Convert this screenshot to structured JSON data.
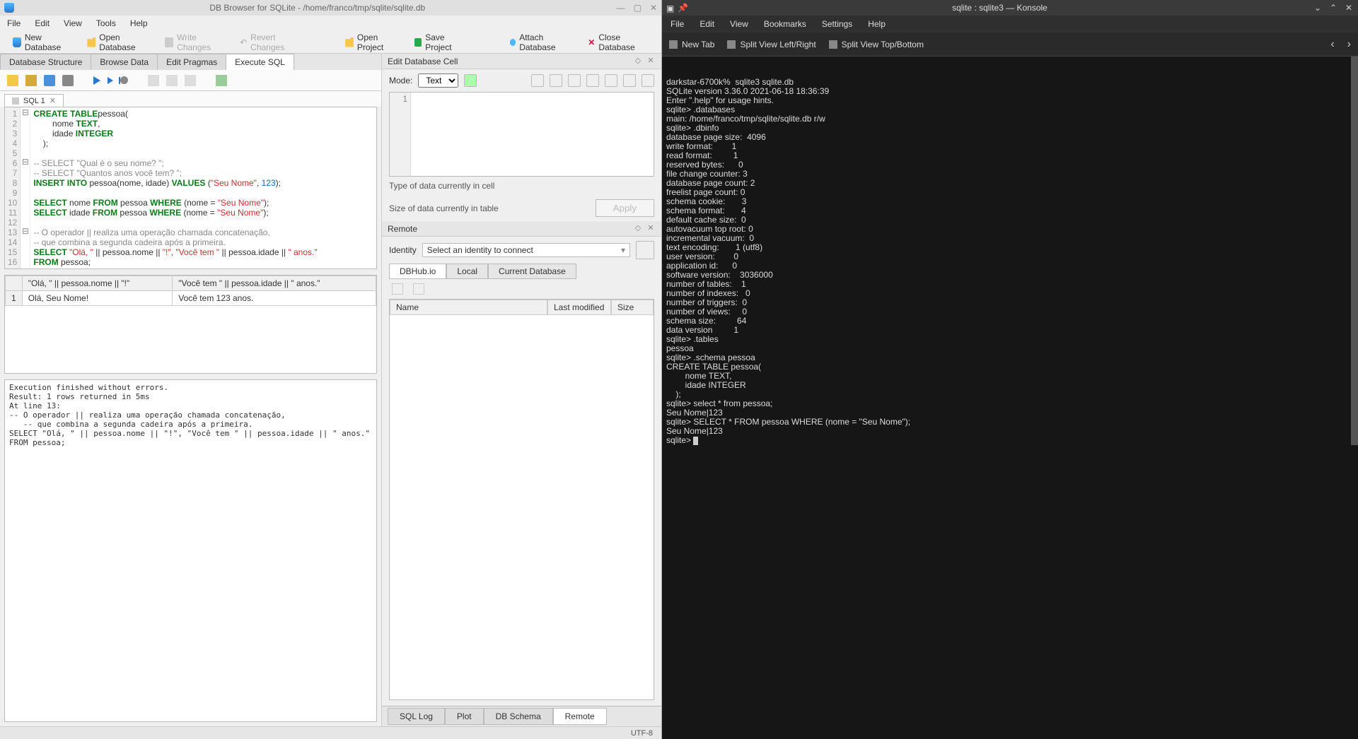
{
  "dbbrowser": {
    "title": "DB Browser for SQLite - /home/franco/tmp/sqlite/sqlite.db",
    "menu": [
      "File",
      "Edit",
      "View",
      "Tools",
      "Help"
    ],
    "toolbar": {
      "new_db": "New Database",
      "open_db": "Open Database",
      "write": "Write Changes",
      "revert": "Revert Changes",
      "open_proj": "Open Project",
      "save_proj": "Save Project",
      "attach": "Attach Database",
      "close": "Close Database"
    },
    "tabs": [
      "Database Structure",
      "Browse Data",
      "Edit Pragmas",
      "Execute SQL"
    ],
    "active_tab": 3,
    "sql_tab": "SQL 1",
    "code_lines": [
      {
        "n": 1,
        "parts": [
          [
            "kw",
            "CREATE TABLE"
          ],
          [
            "",
            ""
          ],
          [
            "",
            "pessoa("
          ]
        ]
      },
      {
        "n": 2,
        "parts": [
          [
            "",
            "        nome "
          ],
          [
            "dk",
            "TEXT"
          ],
          [
            "",
            ","
          ]
        ]
      },
      {
        "n": 3,
        "parts": [
          [
            "",
            "        idade "
          ],
          [
            "dk",
            "INTEGER"
          ]
        ]
      },
      {
        "n": 4,
        "parts": [
          [
            "",
            "    );"
          ]
        ]
      },
      {
        "n": 5,
        "parts": [
          [
            "",
            ""
          ]
        ]
      },
      {
        "n": 6,
        "parts": [
          [
            "cmt",
            "-- SELECT \"Qual é o seu nome? \";"
          ]
        ]
      },
      {
        "n": 7,
        "parts": [
          [
            "cmt",
            "-- SELECT \"Quantos anos você tem? \";"
          ]
        ]
      },
      {
        "n": 8,
        "parts": [
          [
            "kw",
            "INSERT INTO"
          ],
          [
            "",
            " pessoa(nome, idade) "
          ],
          [
            "kw",
            "VALUES"
          ],
          [
            "",
            " ("
          ],
          [
            "str",
            "\"Seu Nome\""
          ],
          [
            "",
            ", "
          ],
          [
            "num",
            "123"
          ],
          [
            "",
            ");"
          ]
        ]
      },
      {
        "n": 9,
        "parts": [
          [
            "",
            ""
          ]
        ]
      },
      {
        "n": 10,
        "parts": [
          [
            "kw",
            "SELECT"
          ],
          [
            "",
            " nome "
          ],
          [
            "kw",
            "FROM"
          ],
          [
            "",
            " pessoa "
          ],
          [
            "kw",
            "WHERE"
          ],
          [
            "",
            " (nome = "
          ],
          [
            "str",
            "\"Seu Nome\""
          ],
          [
            "",
            ");"
          ]
        ]
      },
      {
        "n": 11,
        "parts": [
          [
            "kw",
            "SELECT"
          ],
          [
            "",
            " idade "
          ],
          [
            "kw",
            "FROM"
          ],
          [
            "",
            " pessoa "
          ],
          [
            "kw",
            "WHERE"
          ],
          [
            "",
            " (nome = "
          ],
          [
            "str",
            "\"Seu Nome\""
          ],
          [
            "",
            ");"
          ]
        ]
      },
      {
        "n": 12,
        "parts": [
          [
            "",
            ""
          ]
        ]
      },
      {
        "n": 13,
        "parts": [
          [
            "cmt",
            "-- O operador || realiza uma operação chamada concatenação,"
          ]
        ]
      },
      {
        "n": 14,
        "parts": [
          [
            "cmt",
            "-- que combina a segunda cadeira após a primeira."
          ]
        ]
      },
      {
        "n": 15,
        "parts": [
          [
            "kw",
            "SELECT"
          ],
          [
            "",
            " "
          ],
          [
            "str",
            "\"Olá, \""
          ],
          [
            "",
            " || pessoa.nome || "
          ],
          [
            "str",
            "\"!\""
          ],
          [
            "",
            ", "
          ],
          [
            "str",
            "\"Você tem \""
          ],
          [
            "",
            " || pessoa.idade || "
          ],
          [
            "str",
            "\" anos.\""
          ]
        ]
      },
      {
        "n": 16,
        "parts": [
          [
            "kw",
            "FROM"
          ],
          [
            "",
            " pessoa;"
          ]
        ]
      },
      {
        "n": 17,
        "parts": [
          [
            "",
            ""
          ]
        ]
      }
    ],
    "result_headers": [
      "\"Olá, \" || pessoa.nome || \"!\"",
      "\"Você tem \" || pessoa.idade || \" anos.\""
    ],
    "result_rows": [
      [
        "Olá, Seu Nome!",
        "Você tem 123 anos."
      ]
    ],
    "log": "Execution finished without errors.\nResult: 1 rows returned in 5ms\nAt line 13:\n-- O operador || realiza uma operação chamada concatenação,\n   -- que combina a segunda cadeira após a primeira.\nSELECT \"Olá, \" || pessoa.nome || \"!\", \"Você tem \" || pessoa.idade || \" anos.\"\nFROM pessoa;",
    "status_encoding": "UTF-8",
    "editcell": {
      "title": "Edit Database Cell",
      "mode_label": "Mode:",
      "mode_value": "Text",
      "line1": "1",
      "type_label": "Type of data currently in cell",
      "size_label": "Size of data currently in table",
      "apply": "Apply"
    },
    "remote": {
      "title": "Remote",
      "identity_label": "Identity",
      "identity_value": "Select an identity to connect",
      "tabs": [
        "DBHub.io",
        "Local",
        "Current Database"
      ],
      "cols": [
        "Name",
        "Last modified",
        "Size"
      ]
    },
    "bottom_tabs": [
      "SQL Log",
      "Plot",
      "DB Schema",
      "Remote"
    ],
    "bottom_active": 3
  },
  "konsole": {
    "title": "sqlite : sqlite3 — Konsole",
    "menu": [
      "File",
      "Edit",
      "View",
      "Bookmarks",
      "Settings",
      "Help"
    ],
    "toolbar": {
      "newtab": "New Tab",
      "splitlr": "Split View Left/Right",
      "splittb": "Split View Top/Bottom"
    },
    "terminal_lines": [
      "darkstar-6700k%  sqlite3 sqlite.db",
      "SQLite version 3.36.0 2021-06-18 18:36:39",
      "Enter \".help\" for usage hints.",
      "sqlite> .databases",
      "main: /home/franco/tmp/sqlite/sqlite.db r/w",
      "sqlite> .dbinfo",
      "database page size:  4096",
      "write format:        1",
      "read format:         1",
      "reserved bytes:      0",
      "file change counter: 3",
      "database page count: 2",
      "freelist page count: 0",
      "schema cookie:       3",
      "schema format:       4",
      "default cache size:  0",
      "autovacuum top root: 0",
      "incremental vacuum:  0",
      "text encoding:       1 (utf8)",
      "user version:        0",
      "application id:      0",
      "software version:    3036000",
      "number of tables:    1",
      "number of indexes:   0",
      "number of triggers:  0",
      "number of views:     0",
      "schema size:         64",
      "data version         1",
      "sqlite> .tables",
      "pessoa",
      "sqlite> .schema pessoa",
      "CREATE TABLE pessoa(",
      "        nome TEXT,",
      "        idade INTEGER",
      "    );",
      "sqlite> select * from pessoa;",
      "Seu Nome|123",
      "sqlite> SELECT * FROM pessoa WHERE (nome = \"Seu Nome\");",
      "Seu Nome|123",
      "sqlite> "
    ]
  }
}
